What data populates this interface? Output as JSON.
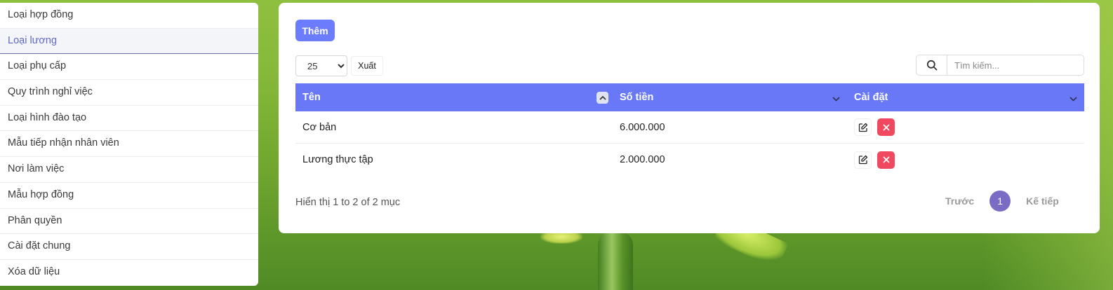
{
  "sidebar": {
    "items": [
      {
        "label": "Loại hợp đồng"
      },
      {
        "label": "Loại lương",
        "active": true
      },
      {
        "label": "Loại phụ cấp"
      },
      {
        "label": "Quy trình nghỉ việc"
      },
      {
        "label": "Loại hình đào tạo"
      },
      {
        "label": "Mẫu tiếp nhận nhân viên"
      },
      {
        "label": "Nơi làm việc"
      },
      {
        "label": "Mẫu hợp đồng"
      },
      {
        "label": "Phân quyền"
      },
      {
        "label": "Cài đặt chung"
      },
      {
        "label": "Xóa dữ liệu"
      }
    ]
  },
  "toolbar": {
    "add_label": "Thêm",
    "page_size": "25",
    "export_label": "Xuất",
    "search_placeholder": "Tìm kiếm..."
  },
  "table": {
    "headers": {
      "name": "Tên",
      "amount": "Số tiền",
      "settings": "Cài đặt"
    },
    "rows": [
      {
        "name": "Cơ bản",
        "amount": "6.000.000"
      },
      {
        "name": "Lương thực tập",
        "amount": "2.000.000"
      }
    ]
  },
  "footer": {
    "info": "Hiển thị 1 to 2 of 2 mục",
    "prev": "Trước",
    "page": "1",
    "next": "Kế tiếp"
  },
  "icons": {
    "search": "search-icon",
    "sort": "chevron-up-icon",
    "dropdown": "chevron-down-icon",
    "edit": "edit-icon",
    "delete": "close-icon"
  },
  "colors": {
    "primary": "#6c7cff",
    "header": "#6878f6",
    "danger": "#f0485e",
    "pager_active": "#7a6bc4",
    "sidebar_active": "#6169c5"
  }
}
